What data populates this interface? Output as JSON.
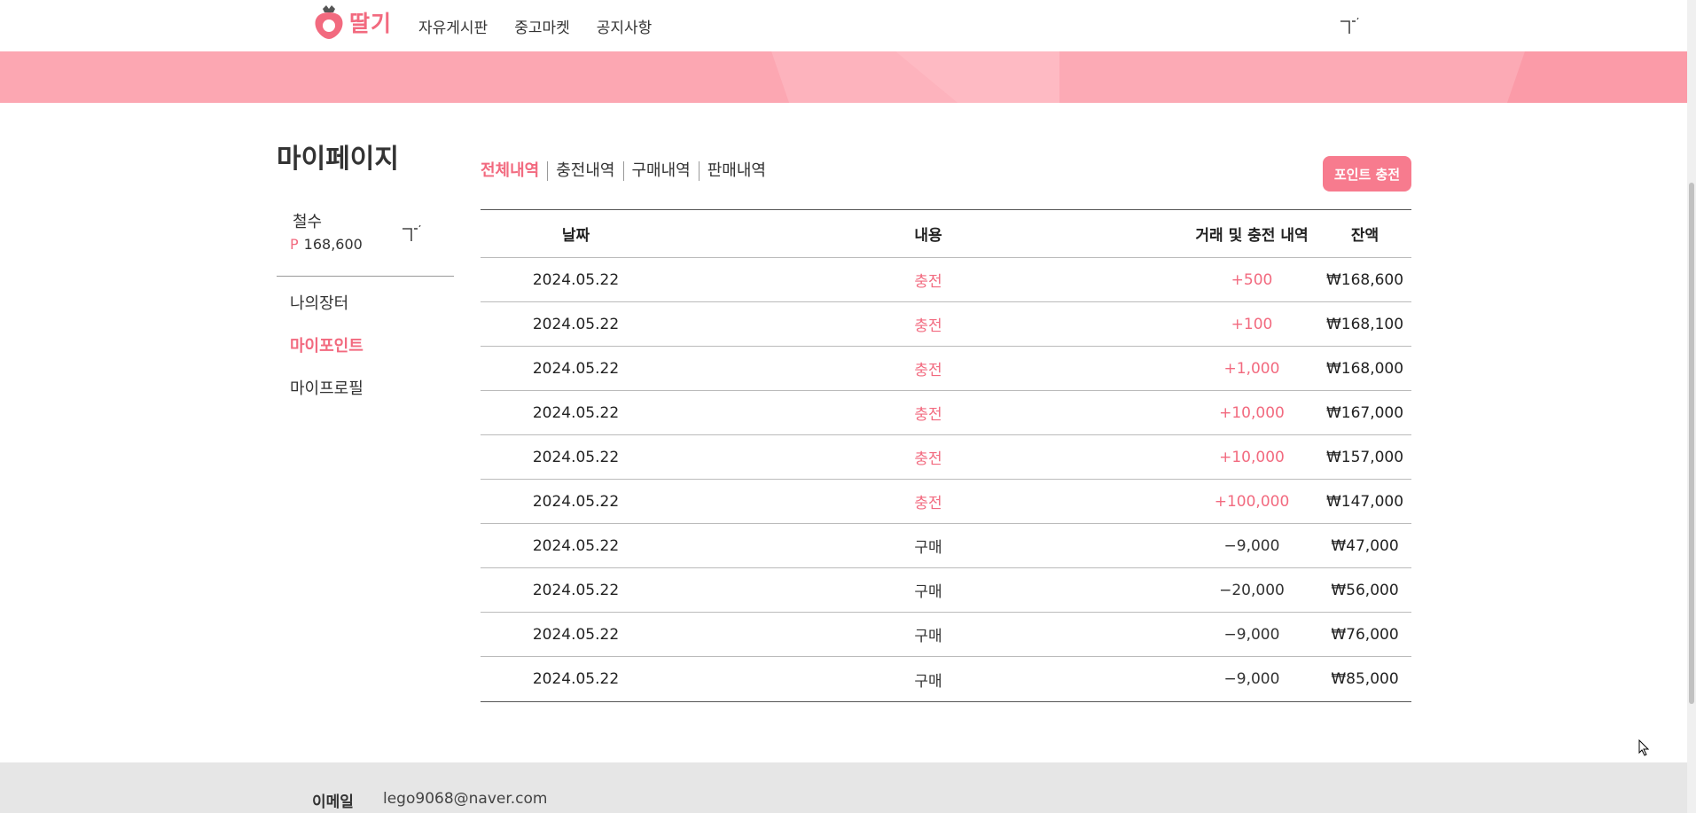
{
  "header": {
    "logo_text": "딸기",
    "nav": [
      "자유게시판",
      "중고마켓",
      "공지사항"
    ]
  },
  "sidebar": {
    "title": "마이페이지",
    "user_name": "철수",
    "point_symbol": "P",
    "points": "168,600",
    "menu": [
      {
        "label": "나의장터",
        "active": false
      },
      {
        "label": "마이포인트",
        "active": true
      },
      {
        "label": "마이프로필",
        "active": false
      }
    ]
  },
  "tabs": [
    {
      "label": "전체내역",
      "active": true
    },
    {
      "label": "충전내역",
      "active": false
    },
    {
      "label": "구매내역",
      "active": false
    },
    {
      "label": "판매내역",
      "active": false
    }
  ],
  "charge_button": "포인트 충전",
  "table": {
    "headers": [
      "날짜",
      "내용",
      "거래 및 충전 내역",
      "잔액"
    ],
    "rows": [
      {
        "date": "2024.05.22",
        "content": "충전",
        "amount": "+500",
        "balance": "₩168,600"
      },
      {
        "date": "2024.05.22",
        "content": "충전",
        "amount": "+100",
        "balance": "₩168,100"
      },
      {
        "date": "2024.05.22",
        "content": "충전",
        "amount": "+1,000",
        "balance": "₩168,000"
      },
      {
        "date": "2024.05.22",
        "content": "충전",
        "amount": "+10,000",
        "balance": "₩167,000"
      },
      {
        "date": "2024.05.22",
        "content": "충전",
        "amount": "+10,000",
        "balance": "₩157,000"
      },
      {
        "date": "2024.05.22",
        "content": "충전",
        "amount": "+100,000",
        "balance": "₩147,000"
      },
      {
        "date": "2024.05.22",
        "content": "구매",
        "amount": "−9,000",
        "balance": "₩47,000"
      },
      {
        "date": "2024.05.22",
        "content": "구매",
        "amount": "−20,000",
        "balance": "₩56,000"
      },
      {
        "date": "2024.05.22",
        "content": "구매",
        "amount": "−9,000",
        "balance": "₩76,000"
      },
      {
        "date": "2024.05.22",
        "content": "구매",
        "amount": "−9,000",
        "balance": "₩85,000"
      }
    ]
  },
  "footer": {
    "label": "이메일",
    "email": "lego9068@naver.com"
  },
  "colors": {
    "accent": "#f26a7f",
    "banner": "#fca7b2",
    "footer_bg": "#e6e6e6"
  },
  "icons": [
    "strawberry-logo-icon",
    "broken-image-icon",
    "mouse-cursor-icon"
  ]
}
